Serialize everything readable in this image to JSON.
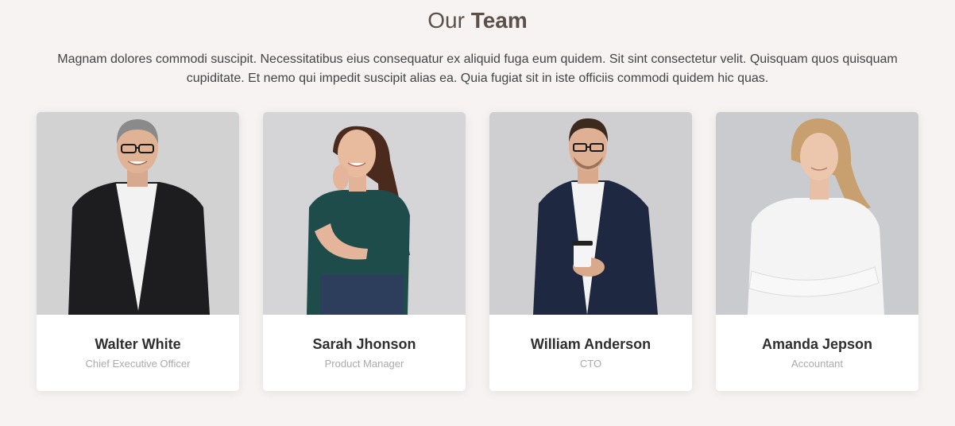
{
  "section": {
    "title_light": "Our",
    "title_strong": "Team",
    "description": "Magnam dolores commodi suscipit. Necessitatibus eius consequatur ex aliquid fuga eum quidem. Sit sint consectetur velit. Quisquam quos quisquam cupiditate. Et nemo qui impedit suscipit alias ea. Quia fugiat sit in iste officiis commodi quidem hic quas."
  },
  "team": [
    {
      "name": "Walter White",
      "role": "Chief Executive Officer",
      "photo_icon": "portrait-man-gray-hair-black-blazer"
    },
    {
      "name": "Sarah Jhonson",
      "role": "Product Manager",
      "photo_icon": "portrait-woman-green-top"
    },
    {
      "name": "William Anderson",
      "role": "CTO",
      "photo_icon": "portrait-man-navy-blazer-coffee"
    },
    {
      "name": "Amanda Jepson",
      "role": "Accountant",
      "photo_icon": "portrait-woman-white-blouse"
    }
  ],
  "colors": {
    "background": "#f6f3f2",
    "card": "#ffffff",
    "title": "#5c504b",
    "name": "#2f2f2f",
    "role": "#aaaaaa"
  }
}
